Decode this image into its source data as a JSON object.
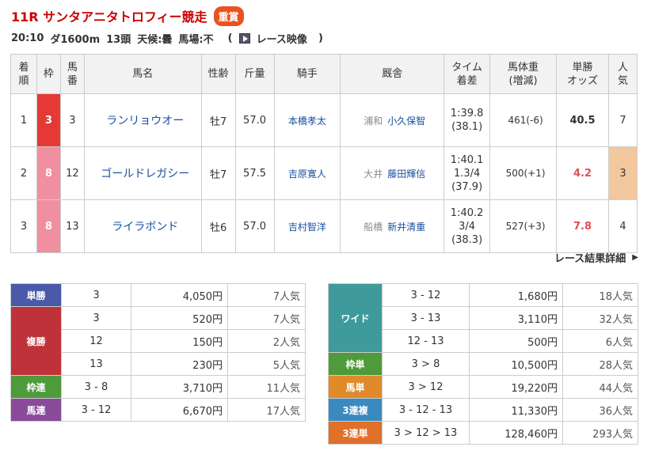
{
  "race": {
    "title": "11R サンタアニタトロフィー競走",
    "grade": "重賞",
    "time": "20:10",
    "course": "ダ1600m",
    "field": "13頭",
    "weather": "天候:曇",
    "track": "馬場:不",
    "video_open": "(",
    "video_label": "レース映像",
    "video_close": ")"
  },
  "results": {
    "headers": [
      "着順",
      "枠",
      "馬番",
      "馬名",
      "性齢",
      "斤量",
      "騎手",
      "厩舎",
      "タイム着差",
      "馬体重(増減)",
      "単勝オッズ",
      "人気"
    ],
    "header_lines": [
      [
        "着",
        "順"
      ],
      [
        "枠"
      ],
      [
        "馬",
        "番"
      ],
      [
        "馬名"
      ],
      [
        "性齢"
      ],
      [
        "斤量"
      ],
      [
        "騎手"
      ],
      [
        "厩舎"
      ],
      [
        "タイム",
        "着差"
      ],
      [
        "馬体重",
        "(増減)"
      ],
      [
        "単勝",
        "オッズ"
      ],
      [
        "人",
        "気"
      ]
    ],
    "rows": [
      {
        "rank": "1",
        "waku": "3",
        "umaban": "3",
        "horse": "ランリョウオー",
        "sexage": "牡7",
        "kinryo": "57.0",
        "jockey": "本橋孝太",
        "region": "浦和",
        "trainer": "小久保智",
        "time_lines": [
          "1:39.8",
          "(38.1)"
        ],
        "weight": "461(-6)",
        "odds": "40.5",
        "pop": "7"
      },
      {
        "rank": "2",
        "waku": "8",
        "umaban": "12",
        "horse": "ゴールドレガシー",
        "sexage": "牡7",
        "kinryo": "57.5",
        "jockey": "吉原寛人",
        "region": "大井",
        "trainer": "藤田輝信",
        "time_lines": [
          "1:40.1",
          "1.3/4",
          "(37.9)"
        ],
        "weight": "500(+1)",
        "odds": "4.2",
        "pop": "3"
      },
      {
        "rank": "3",
        "waku": "8",
        "umaban": "13",
        "horse": "ライラボンド",
        "sexage": "牡6",
        "kinryo": "57.0",
        "jockey": "吉村智洋",
        "region": "船橋",
        "trainer": "新井清重",
        "time_lines": [
          "1:40.2",
          "3/4",
          "(38.3)"
        ],
        "weight": "527(+3)",
        "odds": "7.8",
        "pop": "4"
      }
    ]
  },
  "detail_link": "レース結果詳細",
  "payouts_left": [
    {
      "label": "単勝",
      "color": "#4a5aa8",
      "entries": [
        {
          "num": "3",
          "amt": "4,050円",
          "pop": "7人気"
        }
      ]
    },
    {
      "label": "複勝",
      "color": "#c0323a",
      "entries": [
        {
          "num": "3",
          "amt": "520円",
          "pop": "7人気"
        },
        {
          "num": "12",
          "amt": "150円",
          "pop": "2人気"
        },
        {
          "num": "13",
          "amt": "230円",
          "pop": "5人気"
        }
      ]
    },
    {
      "label": "枠連",
      "color": "#4f9a3a",
      "entries": [
        {
          "num": "3 - 8",
          "amt": "3,710円",
          "pop": "11人気"
        }
      ]
    },
    {
      "label": "馬連",
      "color": "#8a4a9a",
      "entries": [
        {
          "num": "3 - 12",
          "amt": "6,670円",
          "pop": "17人気"
        }
      ]
    }
  ],
  "payouts_right": [
    {
      "label": "ワイド",
      "color": "#3f9b9b",
      "entries": [
        {
          "num": "3 - 12",
          "amt": "1,680円",
          "pop": "18人気"
        },
        {
          "num": "3 - 13",
          "amt": "3,110円",
          "pop": "32人気"
        },
        {
          "num": "12 - 13",
          "amt": "500円",
          "pop": "6人気"
        }
      ]
    },
    {
      "label": "枠単",
      "color": "#4f9a3a",
      "entries": [
        {
          "num": "3 > 8",
          "amt": "10,500円",
          "pop": "28人気"
        }
      ]
    },
    {
      "label": "馬単",
      "color": "#e08a2a",
      "entries": [
        {
          "num": "3 > 12",
          "amt": "19,220円",
          "pop": "44人気"
        }
      ]
    },
    {
      "label": "3連複",
      "color": "#3a8abf",
      "entries": [
        {
          "num": "3 - 12 - 13",
          "amt": "11,330円",
          "pop": "36人気"
        }
      ]
    },
    {
      "label": "3連単",
      "color": "#e0702a",
      "entries": [
        {
          "num": "3 > 12 > 13",
          "amt": "128,460円",
          "pop": "293人気"
        }
      ]
    }
  ]
}
